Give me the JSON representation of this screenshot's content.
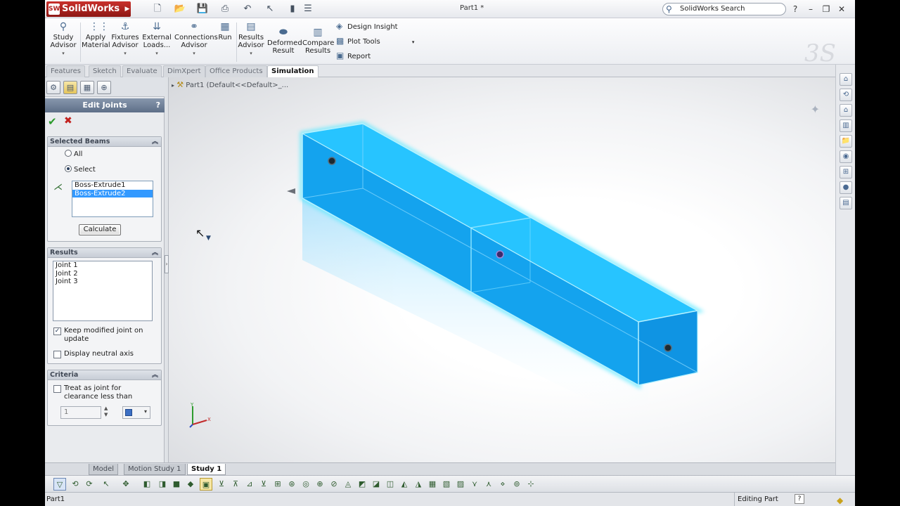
{
  "window": {
    "app_name": "SolidWorks",
    "doc_title": "Part1 *",
    "search_placeholder": "SolidWorks Search",
    "help": "?"
  },
  "commands": [
    {
      "label1": "Study",
      "label2": "Advisor",
      "icon": "magnifier-icon"
    },
    {
      "label1": "Apply",
      "label2": "Material",
      "icon": "material-icon"
    },
    {
      "label1": "Fixtures",
      "label2": "Advisor",
      "icon": "fixture-icon"
    },
    {
      "label1": "External",
      "label2": "Loads...",
      "icon": "load-arrows-icon"
    },
    {
      "label1": "Connections",
      "label2": "Advisor",
      "icon": "connections-icon"
    },
    {
      "label1": "Run",
      "label2": "",
      "icon": "run-icon"
    },
    {
      "label1": "Results",
      "label2": "Advisor",
      "icon": "results-icon"
    },
    {
      "label1": "Deformed",
      "label2": "Result",
      "icon": "deformed-icon"
    },
    {
      "label1": "Compare",
      "label2": "Results",
      "icon": "compare-icon"
    }
  ],
  "command_rows": [
    {
      "label": "Design Insight",
      "icon": "design-insight-icon"
    },
    {
      "label": "Plot Tools",
      "icon": "plot-tools-icon"
    },
    {
      "label": "Report",
      "icon": "report-icon"
    }
  ],
  "cm_tabs": [
    "Features",
    "Sketch",
    "Evaluate",
    "DimXpert",
    "Office Products",
    "Simulation"
  ],
  "property_manager": {
    "title": "Edit Joints",
    "help": "?",
    "selected_beams": {
      "title": "Selected Beams",
      "options": [
        "All",
        "Select"
      ],
      "selected_option": "Select",
      "items": [
        "Boss-Extrude1",
        "Boss-Extrude2"
      ],
      "selected_item": "Boss-Extrude2",
      "calculate": "Calculate"
    },
    "results": {
      "title": "Results",
      "items": [
        "Joint 1",
        "Joint 2",
        "Joint 3"
      ],
      "keep_modified_line1": "Keep modified joint on",
      "keep_modified_line2": "update",
      "keep_modified_checked": true,
      "display_neutral": "Display neutral axis",
      "display_neutral_checked": false
    },
    "criteria": {
      "title": "Criteria",
      "treat_line1": "Treat as joint for",
      "treat_line2": "clearance less than",
      "value": "1"
    }
  },
  "graphics": {
    "tree_flyout": "Part1  (Default<<Default>_..."
  },
  "bottom_tabs": [
    "Model",
    "Motion Study 1",
    "Study 1"
  ],
  "status": {
    "left": "Part1",
    "right": "Editing Part",
    "help": "?"
  },
  "colors": {
    "beam": "#1aa9f2",
    "beam_glow": "#39e0ff",
    "brand_red": "#b21f1c"
  }
}
